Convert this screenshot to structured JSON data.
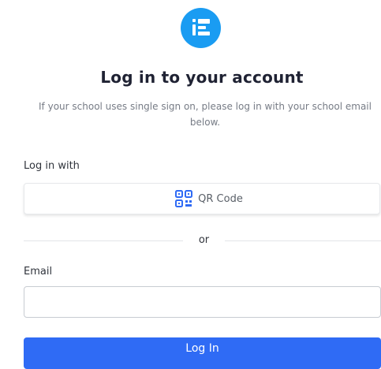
{
  "brand": {
    "logo_icon": "classlink-logo-icon",
    "accent_color": "#1a9cf2"
  },
  "header": {
    "title": "Log in to your account",
    "subtitle_line1": "If your school uses single sign on, please log in with your school email",
    "subtitle_line2": "below."
  },
  "login_with": {
    "label": "Log in with",
    "qr_button": {
      "icon": "qr-code-icon",
      "label": "QR Code"
    }
  },
  "divider": {
    "text": "or"
  },
  "email": {
    "label": "Email",
    "value": "",
    "placeholder": ""
  },
  "submit": {
    "label": "Log In",
    "color": "#2f6bf5"
  }
}
